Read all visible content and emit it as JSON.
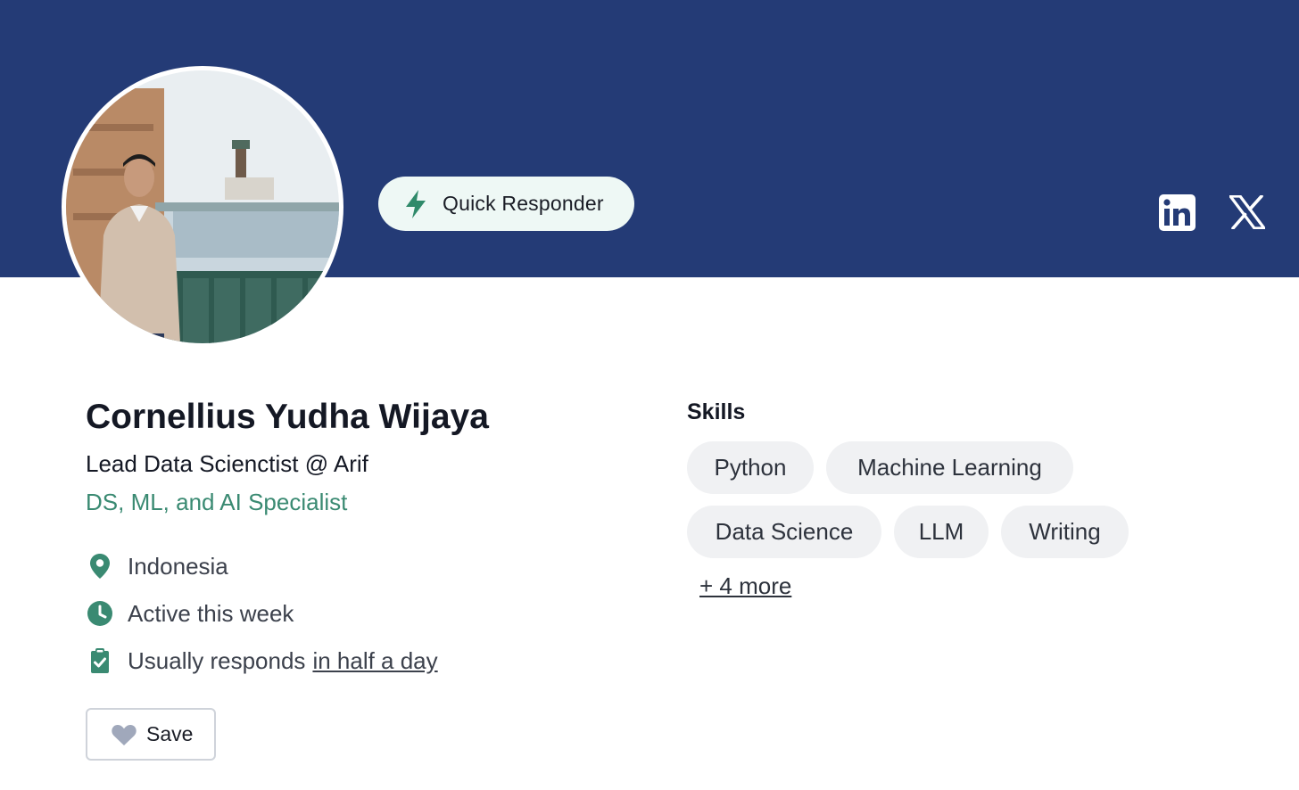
{
  "profile": {
    "name": "Cornellius Yudha Wijaya",
    "headline": "Lead Data Scienctist @ Arif",
    "tagline": "DS, ML, and AI Specialist"
  },
  "badge": {
    "label": "Quick Responder",
    "icon": "lightning-bolt-icon"
  },
  "social": [
    {
      "name": "LinkedIn",
      "icon": "linkedin-icon"
    },
    {
      "name": "X",
      "icon": "x-icon"
    }
  ],
  "meta": {
    "location": "Indonesia",
    "activity": "Active this week",
    "response_prefix": "Usually responds",
    "response_time": "in half a day"
  },
  "save": {
    "label": "Save",
    "icon": "heart-icon"
  },
  "skills": {
    "title": "Skills",
    "items": [
      "Python",
      "Machine Learning",
      "Data Science",
      "LLM",
      "Writing"
    ],
    "more": "+ 4 more"
  },
  "colors": {
    "banner": "#243b76",
    "accent": "#3a8a72",
    "badge_bg": "#eef8f5",
    "chip_bg": "#f0f1f3"
  }
}
